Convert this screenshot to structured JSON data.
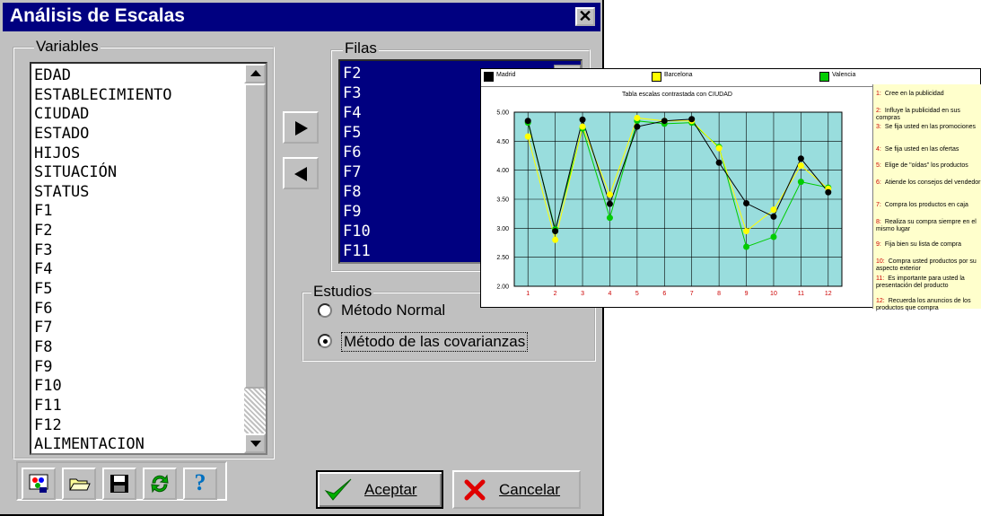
{
  "dialog": {
    "title": "Análisis de Escalas",
    "close_glyph": "✕"
  },
  "variables": {
    "label": "Variables",
    "items": [
      "EDAD",
      "ESTABLECIMIENTO",
      "CIUDAD",
      "ESTADO",
      "HIJOS",
      "SITUACIÓN",
      "STATUS",
      "F1",
      "F2",
      "F3",
      "F4",
      "F5",
      "F6",
      "F7",
      "F8",
      "F9",
      "F10",
      "F11",
      "F12",
      "ALIMENTACION"
    ]
  },
  "filas": {
    "label": "Filas",
    "items": [
      "F2",
      "F3",
      "F4",
      "F5",
      "F6",
      "F7",
      "F8",
      "F9",
      "F10",
      "F11"
    ]
  },
  "estudios": {
    "label": "Estudios",
    "options": [
      "Método Normal",
      "Método de las covarianzas"
    ],
    "selected": "Método de las covarianzas"
  },
  "buttons": {
    "aceptar": "Aceptar",
    "cancelar": "Cancelar"
  },
  "toolbar_icons": [
    "paint-icon",
    "open-folder-icon",
    "save-disk-icon",
    "refresh-icon",
    "help-icon"
  ],
  "chart": {
    "title": "Tabla escalas contrastada con CIUDAD",
    "legend": [
      {
        "name": "Madrid",
        "color": "#000000"
      },
      {
        "name": "Barcelona",
        "color": "#ffff00"
      },
      {
        "name": "Valencia",
        "color": "#00cc00"
      }
    ],
    "descriptions": [
      "Cree en la publicidad",
      "Influye la publicidad en sus compras",
      "Se fija usted en las promociones",
      "Se fija usted en las ofertas",
      "Elige de \"oídas\" los productos",
      "Atiende los consejos del vendedor",
      "Compra los productos en caja",
      "Realiza su compra siempre en el mismo lugar",
      "Fija bien su lista de compra",
      "Compra usted productos por su aspecto exterior",
      "Es importante para usted la presentación del producto",
      "Recuerda los anuncios de los productos que compra"
    ]
  },
  "chart_data": {
    "type": "line",
    "title": "Tabla escalas contrastada con CIUDAD",
    "xlabel": "",
    "ylabel": "",
    "x": [
      1,
      2,
      3,
      4,
      5,
      6,
      7,
      8,
      9,
      10,
      11,
      12
    ],
    "ylim": [
      2.0,
      5.0
    ],
    "yticks": [
      "2.00",
      "2.50",
      "3.00",
      "3.50",
      "4.00",
      "4.50",
      "5.00"
    ],
    "grid": true,
    "legend_position": "top",
    "plot_background": "#99dddd",
    "series": [
      {
        "name": "Madrid",
        "color": "#000000",
        "values": [
          4.85,
          2.95,
          4.87,
          3.42,
          4.75,
          4.85,
          4.88,
          4.13,
          3.43,
          3.2,
          4.2,
          3.62
        ]
      },
      {
        "name": "Barcelona",
        "color": "#ffff00",
        "values": [
          4.58,
          2.8,
          4.75,
          3.58,
          4.9,
          4.85,
          4.85,
          4.38,
          2.95,
          3.32,
          4.08,
          3.68
        ]
      },
      {
        "name": "Valencia",
        "color": "#00cc00",
        "values": [
          4.82,
          2.98,
          4.72,
          3.18,
          4.85,
          4.8,
          4.82,
          4.4,
          2.68,
          2.85,
          3.8,
          3.7
        ]
      }
    ]
  }
}
